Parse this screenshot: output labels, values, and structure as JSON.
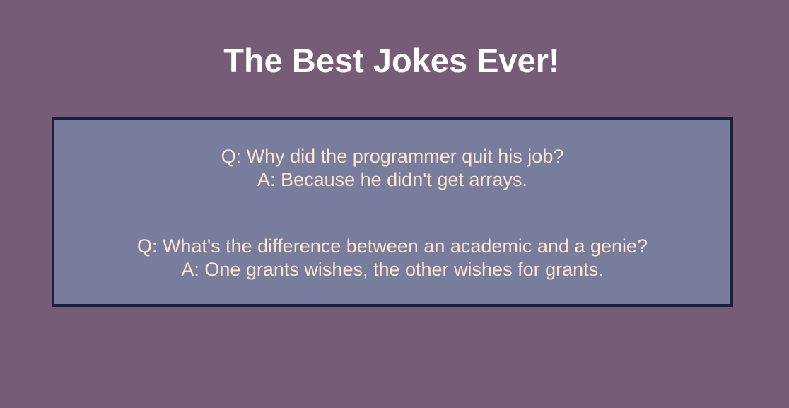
{
  "title": "The Best Jokes Ever!",
  "jokes": [
    {
      "question": "Q: Why did the programmer quit his job?",
      "answer": "A: Because he didn't get arrays."
    },
    {
      "question": "Q: What's the difference between an academic and a genie?",
      "answer": "A: One grants wishes, the other wishes for grants."
    }
  ],
  "colors": {
    "background": "#775c78",
    "box_background": "#787d9e",
    "box_border": "#16213e",
    "title_text": "#ffffff",
    "joke_text": "#ffe5cc"
  }
}
